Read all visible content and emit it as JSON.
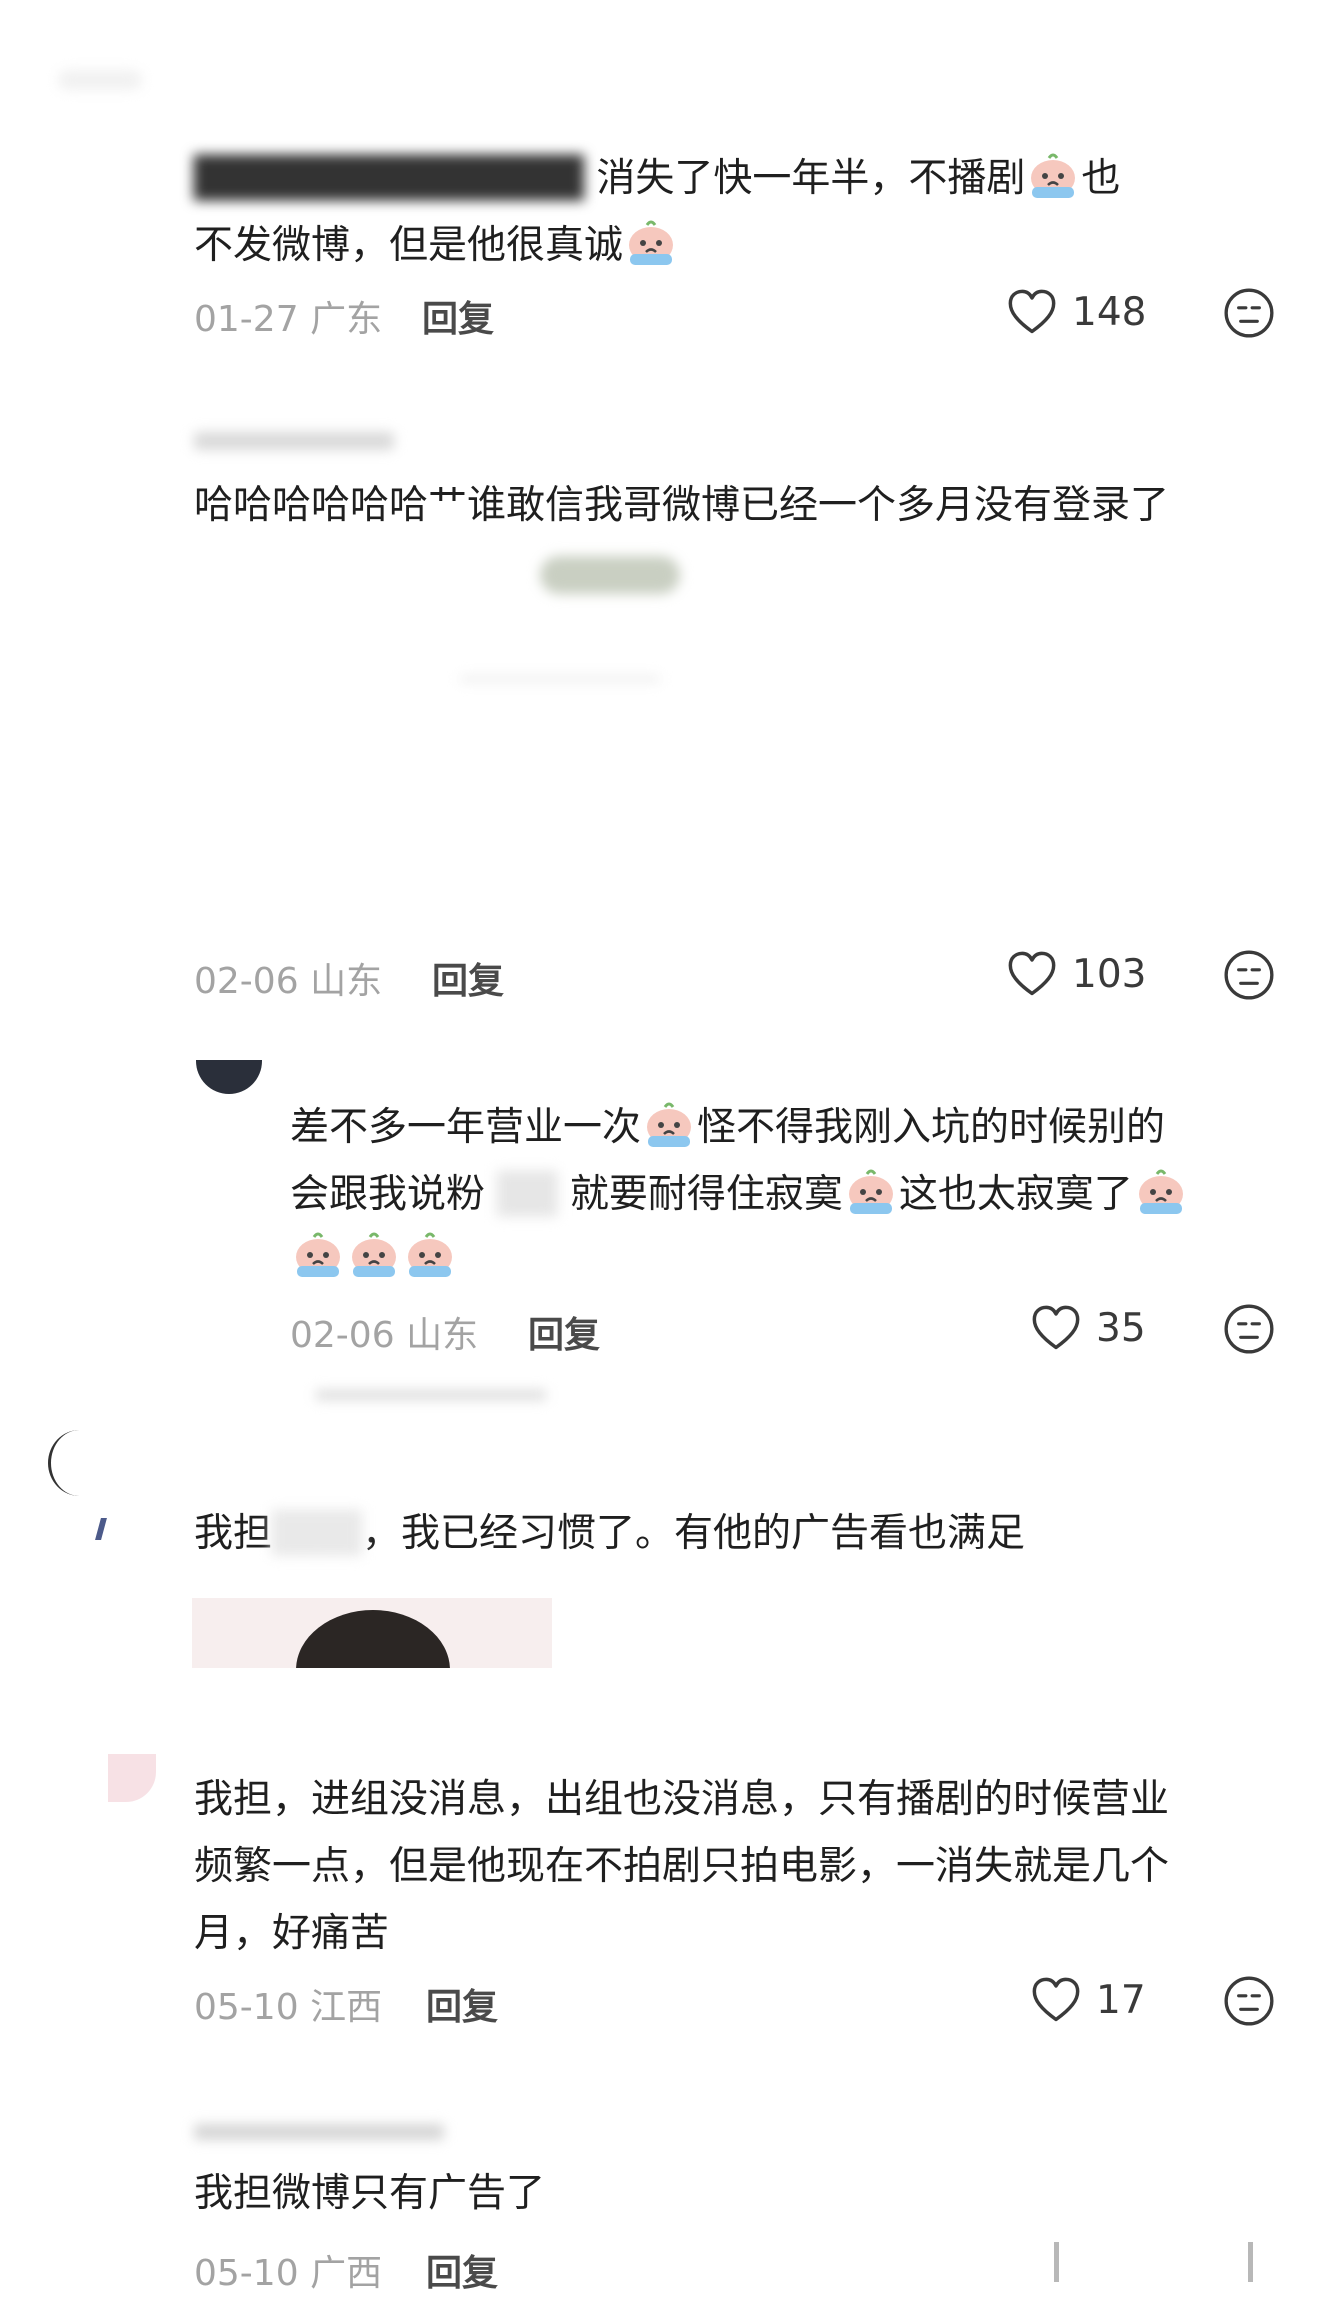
{
  "comments": [
    {
      "line1_pre": "",
      "line1_post": "消失了快一年半，不播剧",
      "line1_tail": "也",
      "line2": "不发微博，但是他很真诚",
      "date": "01-27",
      "region": "广东",
      "reply": "回复",
      "likes": "148"
    },
    {
      "text": "哈哈哈哈哈哈艹谁敢信我哥微博已经一个多月没有登录了",
      "date": "02-06",
      "region": "山东",
      "reply": "回复",
      "likes": "103"
    },
    {
      "line1": "差不多一年营业一次",
      "line1b": "怪不得我刚入坑的时候别的",
      "line2a": "会跟我说粉",
      "line2b": "就要耐得住寂寞",
      "line2c": "这也太寂寞了",
      "date": "02-06",
      "region": "山东",
      "reply": "回复",
      "likes": "35"
    },
    {
      "text_a": "我担",
      "text_b": "，我已经习惯了。有他的广告看也满足"
    },
    {
      "line1": "我担，进组没消息，出组也没消息，只有播剧的时候营业",
      "line2": "频繁一点，但是他现在不拍剧只拍电影，一消失就是几个",
      "line3": "月，好痛苦",
      "date": "05-10",
      "region": "江西",
      "reply": "回复",
      "likes": "17"
    },
    {
      "text": "我担微博只有广告了",
      "date": "05-10",
      "region": "广西",
      "reply": "回复"
    }
  ],
  "icons": {
    "like": "heart-outline-icon",
    "dislike": "neutral-face-icon",
    "emoji": "crying-peach-emoji"
  },
  "colors": {
    "meta": "#a3a3a3",
    "text": "#1f1f1f",
    "icon": "#3a3a3a"
  }
}
